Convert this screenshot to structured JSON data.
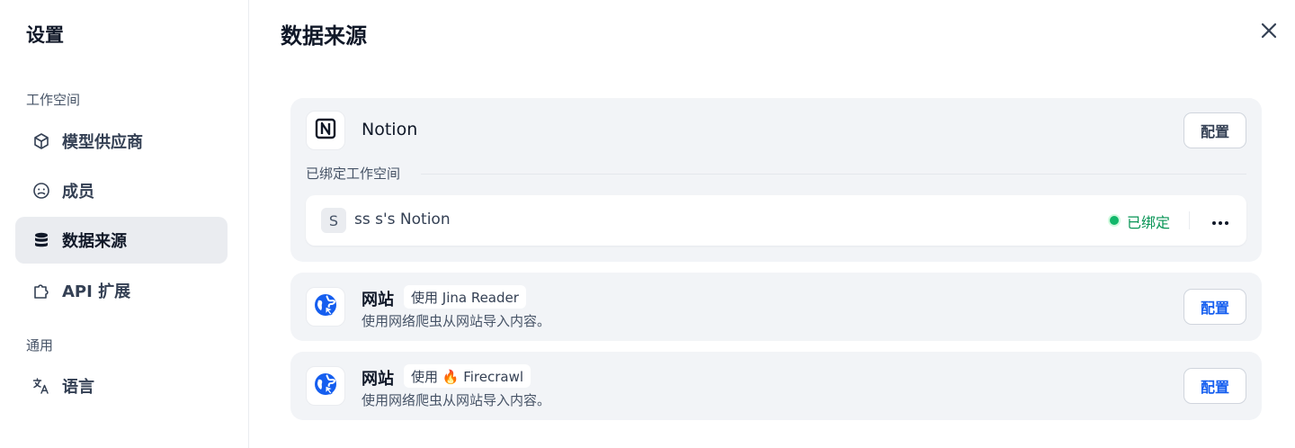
{
  "sidebar": {
    "title": "设置",
    "sections": [
      {
        "label": "工作空间"
      },
      {
        "label": "通用"
      }
    ],
    "items": [
      {
        "label": "模型供应商",
        "icon": "cube-icon"
      },
      {
        "label": "成员",
        "icon": "members-icon"
      },
      {
        "label": "数据来源",
        "icon": "database-icon",
        "active": true
      },
      {
        "label": "API 扩展",
        "icon": "puzzle-icon"
      },
      {
        "label": "语言",
        "icon": "translate-icon"
      }
    ]
  },
  "main": {
    "title": "数据来源",
    "close_icon": "close-icon",
    "notion": {
      "name": "Notion",
      "config_label": "配置",
      "bound_label": "已绑定工作空间",
      "workspace": {
        "avatar": "S",
        "name": "ss s's Notion",
        "status": "已绑定",
        "status_color": "#12b76a"
      }
    },
    "websites": [
      {
        "title": "网站",
        "tag": "使用 Jina Reader",
        "description": "使用网络爬虫从网站导入内容。",
        "config_label": "配置"
      },
      {
        "title": "网站",
        "tag": "使用 🔥 Firecrawl",
        "description": "使用网络爬虫从网站导入内容。",
        "config_label": "配置"
      }
    ]
  },
  "colors": {
    "accent": "#155eef",
    "active_bg": "#eaecf0",
    "card_bg": "#f2f4f7"
  }
}
